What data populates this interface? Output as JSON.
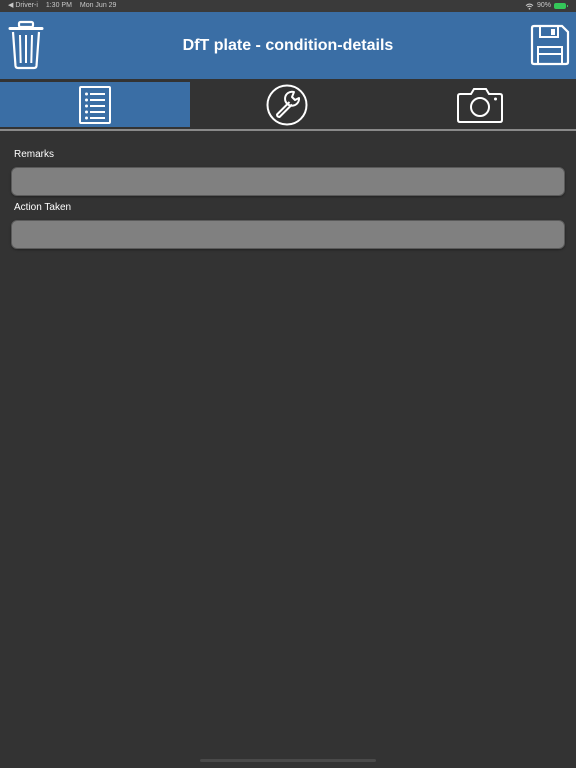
{
  "status_bar": {
    "back_app": "◀ Driver-i",
    "time": "1:30 PM",
    "date": "Mon Jun 29",
    "battery": "90%"
  },
  "header": {
    "title": "DfT plate - condition-details",
    "delete_icon": "trash-icon",
    "save_icon": "floppy-disk-icon"
  },
  "tabs": [
    {
      "name": "details",
      "icon": "list-icon",
      "active": true
    },
    {
      "name": "tools",
      "icon": "wrench-icon",
      "active": false
    },
    {
      "name": "camera",
      "icon": "camera-icon",
      "active": false
    }
  ],
  "form": {
    "remarks": {
      "label": "Remarks",
      "value": ""
    },
    "action_taken": {
      "label": "Action Taken",
      "value": ""
    }
  },
  "colors": {
    "header_bg": "#3a6ea5",
    "page_bg": "#333333",
    "field_bg": "#808080",
    "battery": "#34c759"
  }
}
